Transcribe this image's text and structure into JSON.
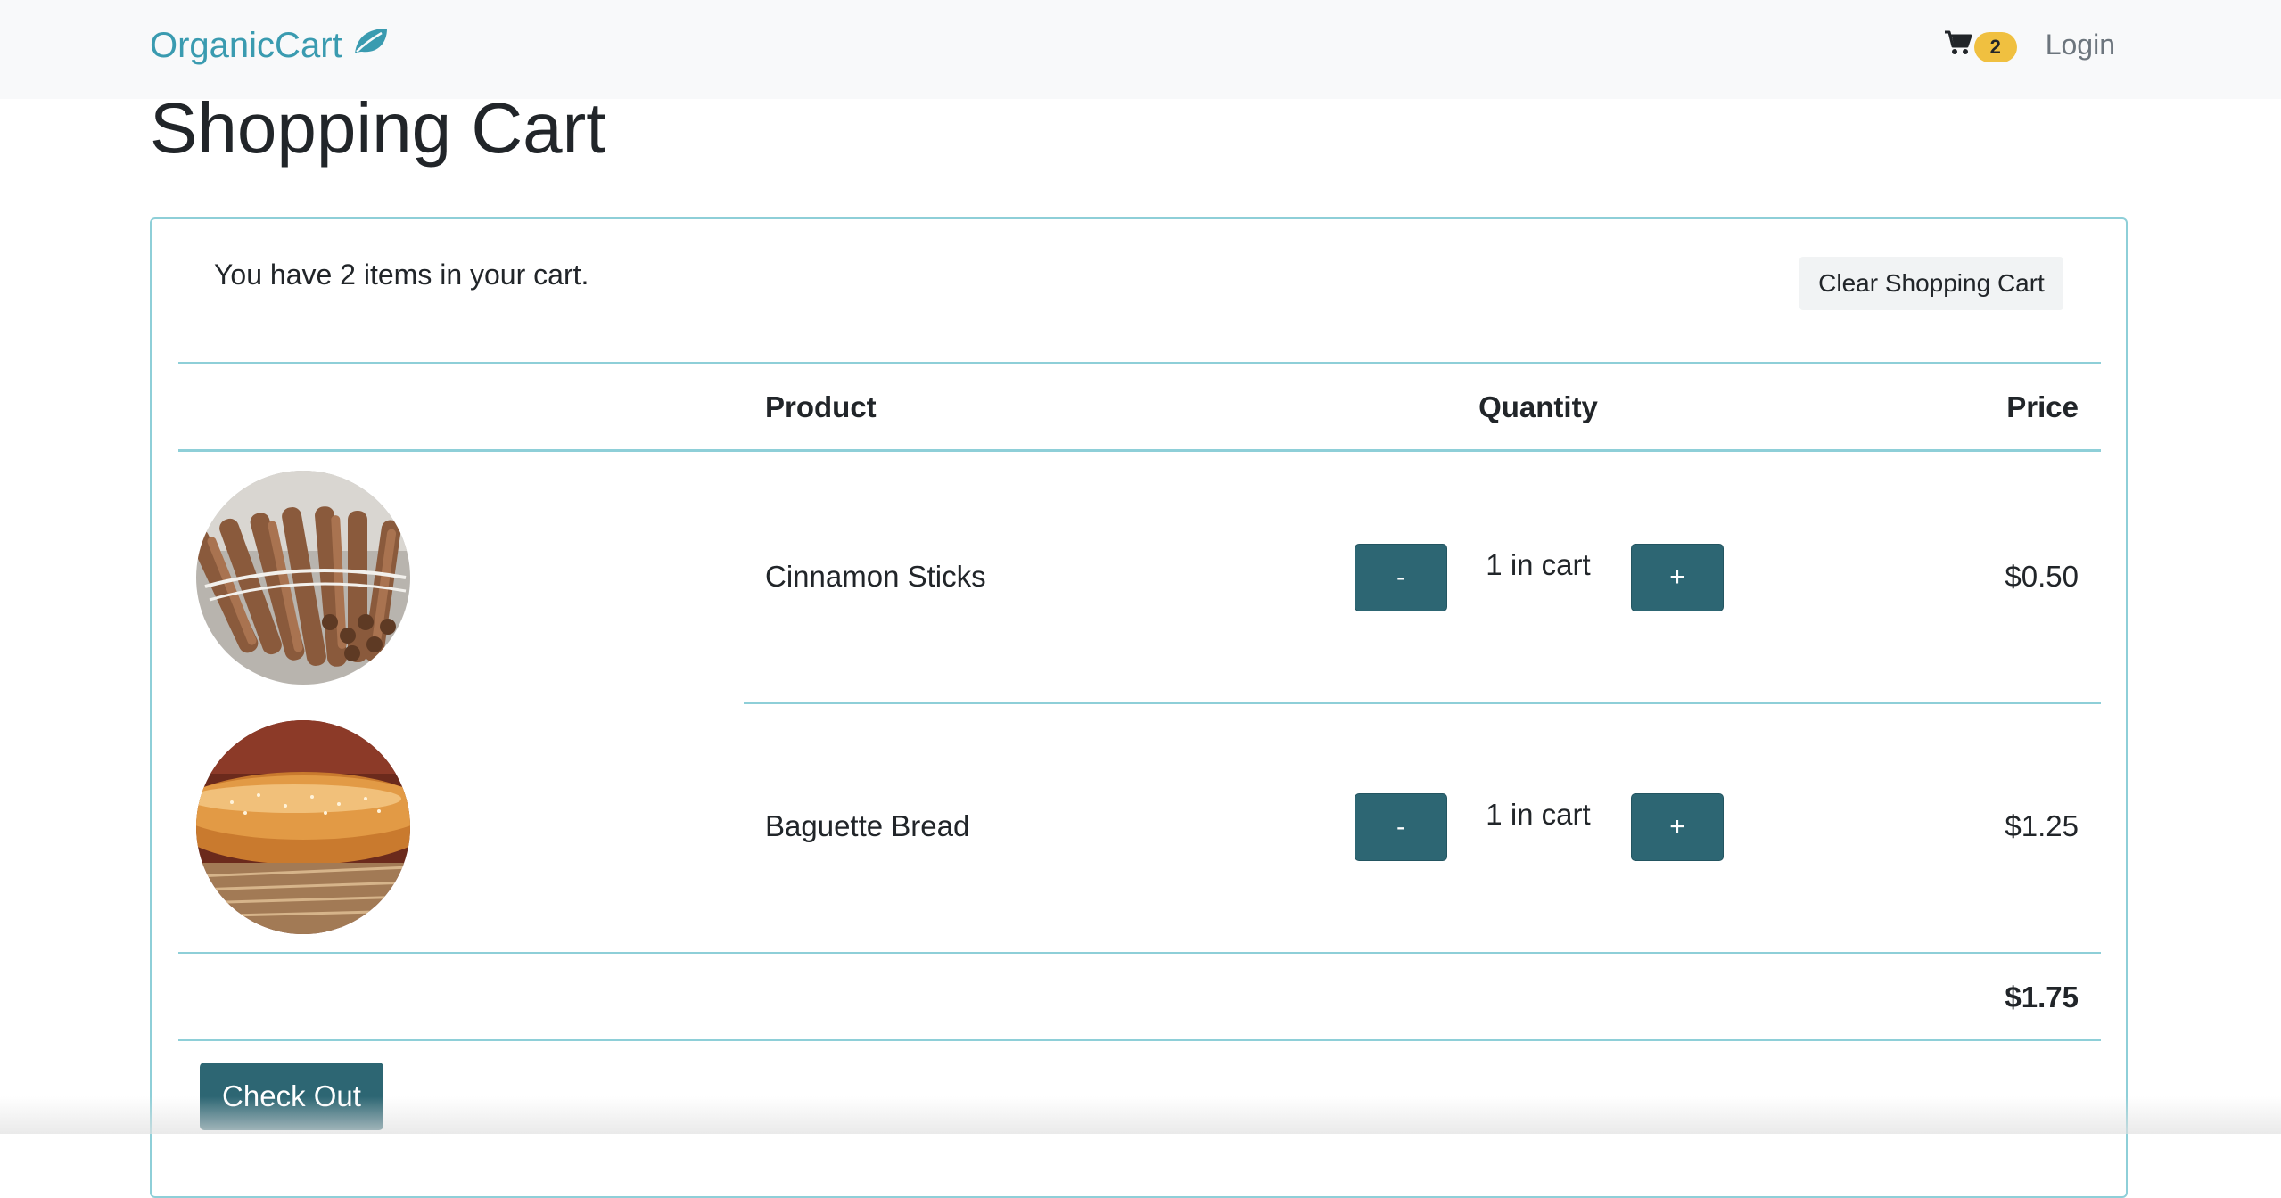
{
  "navbar": {
    "brand": "OrganicCart",
    "brand_icon": "leaf-icon",
    "cart_icon": "shopping-cart-icon",
    "cart_count": "2",
    "login_label": "Login",
    "brand_color": "#3a9bb0",
    "badge_color": "#f0c040"
  },
  "page": {
    "title": "Shopping Cart"
  },
  "cart": {
    "count_text": "You have 2 items in your cart.",
    "clear_label": "Clear Shopping Cart",
    "headers": {
      "product": "Product",
      "quantity": "Quantity",
      "price": "Price"
    },
    "items": [
      {
        "name": "Cinnamon Sticks",
        "image": "cinnamon-sticks-photo",
        "decrement_label": "-",
        "quantity_text": "1 in cart",
        "increment_label": "+",
        "price": "$0.50"
      },
      {
        "name": "Baguette Bread",
        "image": "baguette-bread-photo",
        "decrement_label": "-",
        "quantity_text": "1 in cart",
        "increment_label": "+",
        "price": "$1.25"
      }
    ],
    "total": "$1.75",
    "checkout_label": "Check Out",
    "accent_color": "#2d6673",
    "border_color": "#8ecfd8"
  }
}
